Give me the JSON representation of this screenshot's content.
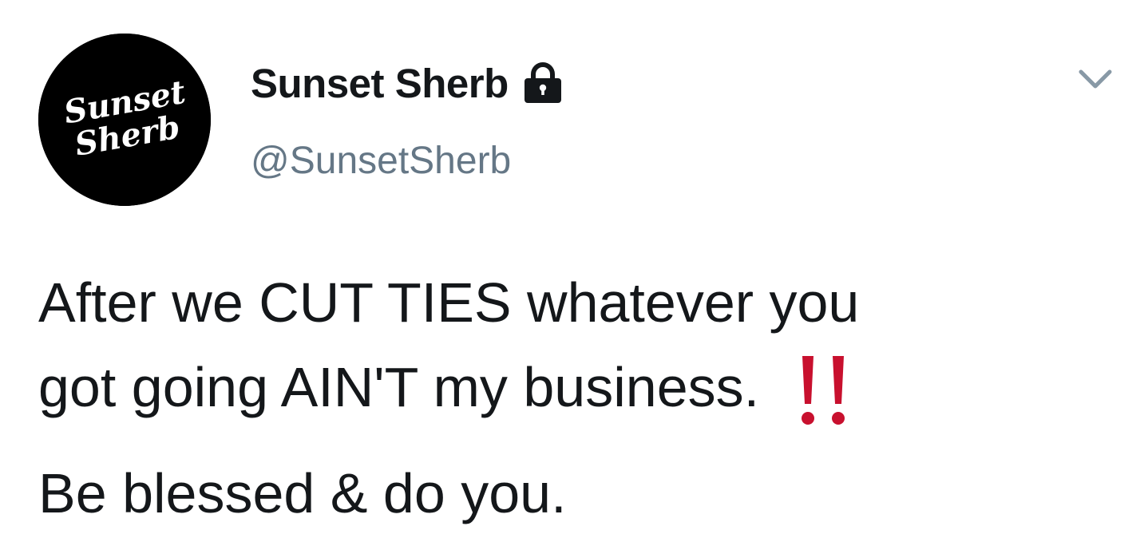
{
  "tweet": {
    "author": {
      "display_name": "Sunset Sherb",
      "handle": "@SunsetSherb",
      "avatar_text_line1": "Sunset",
      "avatar_text_line2": "Sherb",
      "protected_icon": "lock-icon"
    },
    "menu_icon": "chevron-down-icon",
    "text_lines": [
      "After we CUT TIES whatever you",
      "got going AIN'T my business.",
      "Be blessed & do you."
    ],
    "emoji": "double-exclamation-mark-icon",
    "colors": {
      "text": "#14171a",
      "handle": "#657786",
      "caret": "#8899a6",
      "emoji": "#c8102e",
      "avatar_bg": "#000000"
    }
  }
}
